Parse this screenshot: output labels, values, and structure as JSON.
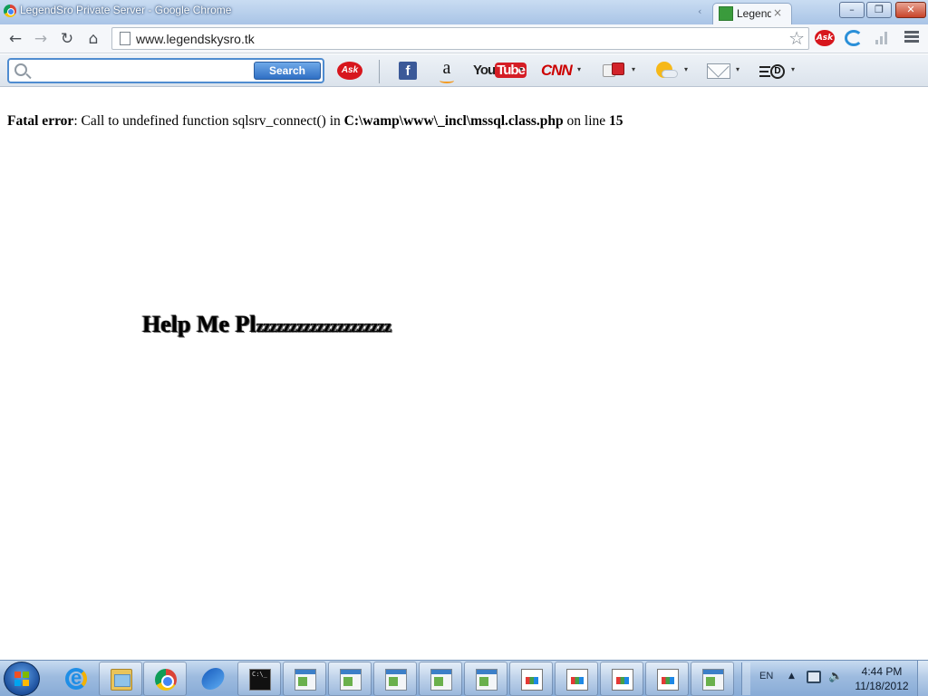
{
  "window": {
    "title": "LegendSro Private Server - Google Chrome",
    "controls": {
      "minimize": "–",
      "maximize": "❐",
      "close": "✕"
    }
  },
  "tab": {
    "label": "Legend",
    "close": "×",
    "scroll_left": "‹"
  },
  "toolbar": {
    "back": "←",
    "forward": "→",
    "reload": "↻",
    "home": "⌂",
    "url": "www.legendskysro.tk",
    "bookmark_star": "☆"
  },
  "ask_toolbar": {
    "search_placeholder": "",
    "search_button": "Search",
    "ask_logo": "Ask",
    "facebook": "f",
    "amazon": "a",
    "youtube_you": "You",
    "youtube_tube": "Tube",
    "cnn": "CNN",
    "dictionary": "D",
    "caret": "▾"
  },
  "extensions": {
    "ask": "Ask"
  },
  "page": {
    "error": {
      "label": "Fatal error",
      "message_1": ": Call to undefined function sqlsrv_connect() in ",
      "path": "C:\\wamp\\www\\_incl\\mssql.class.php",
      "message_2": " on line ",
      "line": "15"
    },
    "heading_main": "Help Me Pl",
    "heading_tail": "zzzzzzzzzzzzzzzzzzzz"
  },
  "taskbar": {
    "language": "EN",
    "tray_arrow": "▲",
    "volume": "🔈",
    "time": "4:44 PM",
    "date": "11/18/2012"
  },
  "colors": {
    "ask_blue": "#4f8cd0",
    "ask_red": "#d7161d",
    "facebook_blue": "#3b5998",
    "cnn_red": "#cc0000"
  },
  "icons": [
    "chrome-icon",
    "back-arrow-icon",
    "forward-arrow-icon",
    "reload-icon",
    "home-icon",
    "page-icon",
    "star-icon",
    "search-icon",
    "facebook-icon",
    "amazon-icon",
    "youtube-icon",
    "cnn-icon",
    "dice-icon",
    "weather-icon",
    "mail-icon",
    "dictionary-icon",
    "windows-start-icon",
    "internet-explorer-icon",
    "folder-icon",
    "command-prompt-icon",
    "network-icon",
    "volume-icon"
  ]
}
